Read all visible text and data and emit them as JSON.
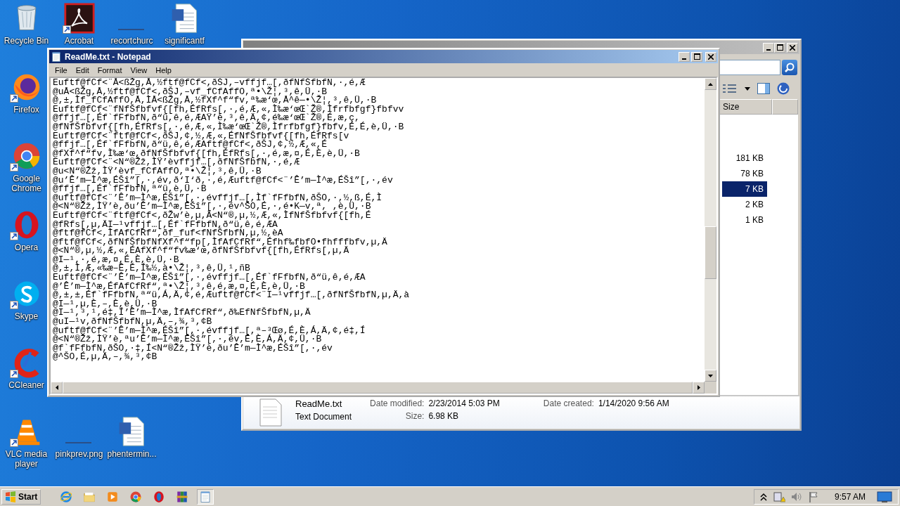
{
  "desktop_icons": [
    {
      "label": "Recycle Bin",
      "kind": "recycle",
      "shortcut": false
    },
    {
      "label": "Acrobat",
      "kind": "acrobat",
      "shortcut": true
    },
    {
      "label": "recortchurc",
      "kind": "blank",
      "shortcut": false
    },
    {
      "label": "significantf",
      "kind": "word",
      "shortcut": false
    },
    {
      "label": "Firefox",
      "kind": "firefox",
      "shortcut": true
    },
    {
      "label": "Google Chrome",
      "kind": "chrome",
      "shortcut": true
    },
    {
      "label": "Opera",
      "kind": "opera",
      "shortcut": true
    },
    {
      "label": "Skype",
      "kind": "skype",
      "shortcut": true
    },
    {
      "label": "CCleaner",
      "kind": "ccleaner",
      "shortcut": true
    },
    {
      "label": "VLC media player",
      "kind": "vlc",
      "shortcut": true
    },
    {
      "label": "pinkprev.png",
      "kind": "blank",
      "shortcut": false
    },
    {
      "label": "phentermin...",
      "kind": "word",
      "shortcut": false
    }
  ],
  "explorer": {
    "size_header": "Size",
    "files": [
      {
        "size": "181 KB",
        "selected": false
      },
      {
        "size": "78 KB",
        "selected": false
      },
      {
        "size": "7 KB",
        "selected": true
      },
      {
        "size": "2 KB",
        "selected": false
      },
      {
        "size": "1 KB",
        "selected": false
      }
    ],
    "details": {
      "name": "ReadMe.txt",
      "type": "Text Document",
      "fields": [
        {
          "label": "Date modified:",
          "value": "2/23/2014 5:03 PM"
        },
        {
          "label": "Size:",
          "value": "6.98 KB"
        }
      ],
      "created": {
        "label": "Date created:",
        "value": "1/14/2020 9:56 AM"
      }
    }
  },
  "notepad": {
    "title": "ReadMe.txt - Notepad",
    "menu": [
      "File",
      "Edit",
      "Format",
      "View",
      "Help"
    ],
    "lines": [
      "Euftf@fCf<¨Å<ßŽg,Å,½ftf@fCf<,ðŠJ,–vffjf…[,ðfNfŠfbfN,·,é,Æ",
      "@uÅ<ßŽg,Å,½ftf@fCf<,ðŠJ,–vf_fCfAffO,ª•\\Ž¦,³,ê,Ü,·B",
      "@,±,Ìf_fCfAffO,Å,ÌÅ<ßŽg,Å,½fXf^f“fv,ª‰æ‘œ,Å^ê—•\\Ž¦,³,ê,Ü,·B",
      "Euftf@fCf<¨fNfŠfbfvf{[fh,ÉfRfs[,·,é,Æ,«,Ì‰æ‘œŒ`Ž®,Ìfrfbfgf}fbfvv",
      "@ffjf…[,Éf`fFfbfN,ð“ü,ê,é,ÆAŸ’è,³,ê,Ä,¢,é‰æ‘œŒ`Ž®,É,æ,ç,",
      "@fNfŠfbfvf{[fh,ÉfRfs[,·,é,Æ,«,Ì‰æ‘œŒ`Ž®,Ìfrfbfgf}fbfv,É,É,è,Ü,·B",
      "Euftf@fCf<¨ftf@fCf<,ðŠJ,¢,½,Æ,«,ÉfNfŠfbfvf{[fh,ÉfRfs[v",
      "@ffjf…[,Éf`fFfbfN,ð“ü,ê,é,ÆAftf@fCf<,ðŠJ,¢,½,Æ,«,É",
      "@fXf^f“fv,Ì‰æ‘œ,ðfNfŠfbfvf{[fh,ÉfRfs[,·,é,æ,¤,É,È,è,Ü,·B",
      "Euftf@fCf<¨<N“®Žž,ÌŸ’èvffjf…[,ðfNfŠfbfN,·,é,Æ",
      "@u<N“®Žž,ÌŸ’èvf_fCfAffO,ª•\\Ž¦,³,ê,Ü,·B",
      "@u’Ê’m—Ì^æ,ÉŠî”[,·,év,ð‘I‘ð,·,é,Æuftf@fCf<¨’Ê’m—Ì^æ,ÉŠî”[,·,év",
      "@ffjf…[,Éf`fFfbfN,ª“ü,è,Ü,·B",
      "@uftf@fCf<¨’Ê’m—Ì^æ,ÉŠî”[,·,évffjf…[,Ìf`fFfbfN,ðŠO,·,½,ß,É,Ì",
      "@<N“®Žž,ÌŸ’è,ðu’Ê’m—Ì^æ,ÉŠî”[,·,év^ŠO,É,·,é•K—v,ª, ,è,Ü,·B",
      "Euftf@fCf<¨ftf@fCf<,ðŽw’è,µ,Ä<N“®,µ,½,Æ,«,ÌfNfŠfbfvf{[fh,É",
      "@fRfs[,µ,ÄI—¹vffjf…[,Éf`fFfbfN,ð“ü,ê,é,ÆA",
      "@ftf@fCf<,ÌfAfCfRf“,ðf_fuf<fNfŠfbfN,µ,½,èA",
      "@ftf@fCf<,ðfNfŠfbfNfXf^f“fp[,ÌfAfCfRf“,Éfhf‰fbfO•fhfffbfv,µ,Ä",
      "@<N“®,µ,½,Æ,«,ÉAfXf^f“fv‰æ‘œ,ðfNfŠfbfvf{[fh,ÉfRfs[,µ,Ä",
      "@I—¹,·,é,æ,¤,É,È,è,Ü,·B",
      "@,±,Ì,Æ,«‰æ–Ê,É,Í‰½,à•\\Ž¦,³,ê,Ü,¹,ñB",
      "Euftf@fCf<¨’Ê’m—Ì^æ,ÉŠî”[,·,évffjf…[,Éf`fFfbfN,ð“ü,ê,é,ÆA",
      "@’Ê’m—Ì^æ,ÉfAfCfRf“,ª•\\Ž¦,³,ê,é,æ,¤,É,È,è,Ü,·B",
      "@,±,±,Éf`fFfbfN,ª“ü,Á,Ä,¢,é,Æuftf@fCf<¨I—¹vffjf…[,ðfNfŠfbfN,µ,Ä,à",
      "@I—¹,µ,È,–,È,è,Ü,·B",
      "@I—¹,³,¹,é‡,Í’Ê’m—Ì^æ,ÌfAfCfRf“,ð‰EfNfŠfbfN,µ,Ä",
      "@uI—¹v,ðfNfŠfbfN,µ,Ä,–,¾,³,¢B",
      "@uftf@fCf<¨’Ê’m—Ì^æ,ÉŠî”[,·,évffjf…[,ª–³Œø,É,È,Á,Ä,¢,é‡,Í",
      "@<N“®Žž,ÌŸ’è,ªu’Ê’m—Ì^æ,ÉŠî”[,·,év,É,È,Á,Ä,¢,Ü,·B",
      "@f`fFfbfN,ðŠO,·‡,Í<N“®Žž,ÌŸ’è,ðu’Ê’m—Ì^æ,ÉŠî”[,·,év",
      "@^ŠO,É,µ,Ä,–,¾,³,¢B"
    ]
  },
  "taskbar": {
    "start": "Start",
    "apps": [
      {
        "kind": "ie",
        "active": false
      },
      {
        "kind": "folder",
        "active": false
      },
      {
        "kind": "media",
        "active": false
      },
      {
        "kind": "chrome",
        "active": false
      },
      {
        "kind": "opera",
        "active": false
      },
      {
        "kind": "archive",
        "active": false
      },
      {
        "kind": "notepad",
        "active": true
      }
    ],
    "clock": "9:57 AM"
  }
}
